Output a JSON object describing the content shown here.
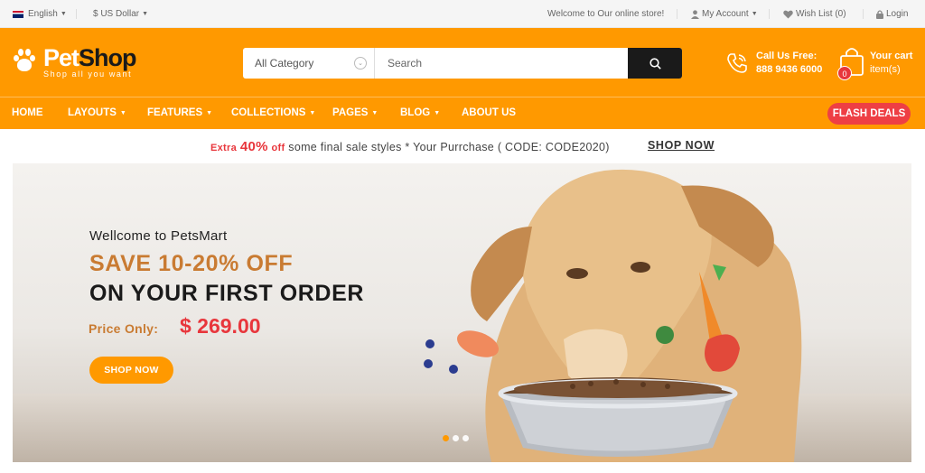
{
  "topbar": {
    "language": "English",
    "currency": "$ US Dollar",
    "welcome": "Welcome to Our online store!",
    "account": "My Account",
    "wishlist": "Wish List (0)",
    "login": "Login"
  },
  "header": {
    "logo_pet": "Pet",
    "logo_shop": "Shop",
    "tagline": "Shop all you want",
    "search": {
      "category": "All Category",
      "placeholder": "Search"
    },
    "call_label": "Call Us Free:",
    "call_number": "888 9436 6000",
    "cart_label": "Your cart",
    "cart_items": "item(s)",
    "cart_count": "0"
  },
  "nav": {
    "items": [
      "HOME",
      "LAYOUTS",
      "FEATURES",
      "COLLECTIONS",
      "PAGES",
      "BLOG",
      "ABOUT US"
    ],
    "flash": "FLASH DEALS"
  },
  "promo": {
    "extra": "Extra",
    "percent": "40%",
    "off": "off",
    "text": "some final sale styles * Your Purrchase ( CODE: CODE2020)",
    "link": "SHOP NOW"
  },
  "hero": {
    "greeting": "Wellcome to PetsMart",
    "headline1": "SAVE 10-20% OFF",
    "headline2": "ON YOUR FIRST ORDER",
    "price_label": "Price Only:",
    "price": "$ 269.00",
    "cta": "SHOP NOW",
    "slides": 3,
    "active_slide": 1
  },
  "colors": {
    "brand": "#ff9900",
    "accent": "#e8363c",
    "dark": "#1a1a1a",
    "headline_orange": "#c97b32"
  },
  "icons": [
    "flag-icon",
    "user-icon",
    "heart-icon",
    "lock-icon",
    "paw-icon",
    "search-icon",
    "phone-icon",
    "cart-bag-icon"
  ]
}
